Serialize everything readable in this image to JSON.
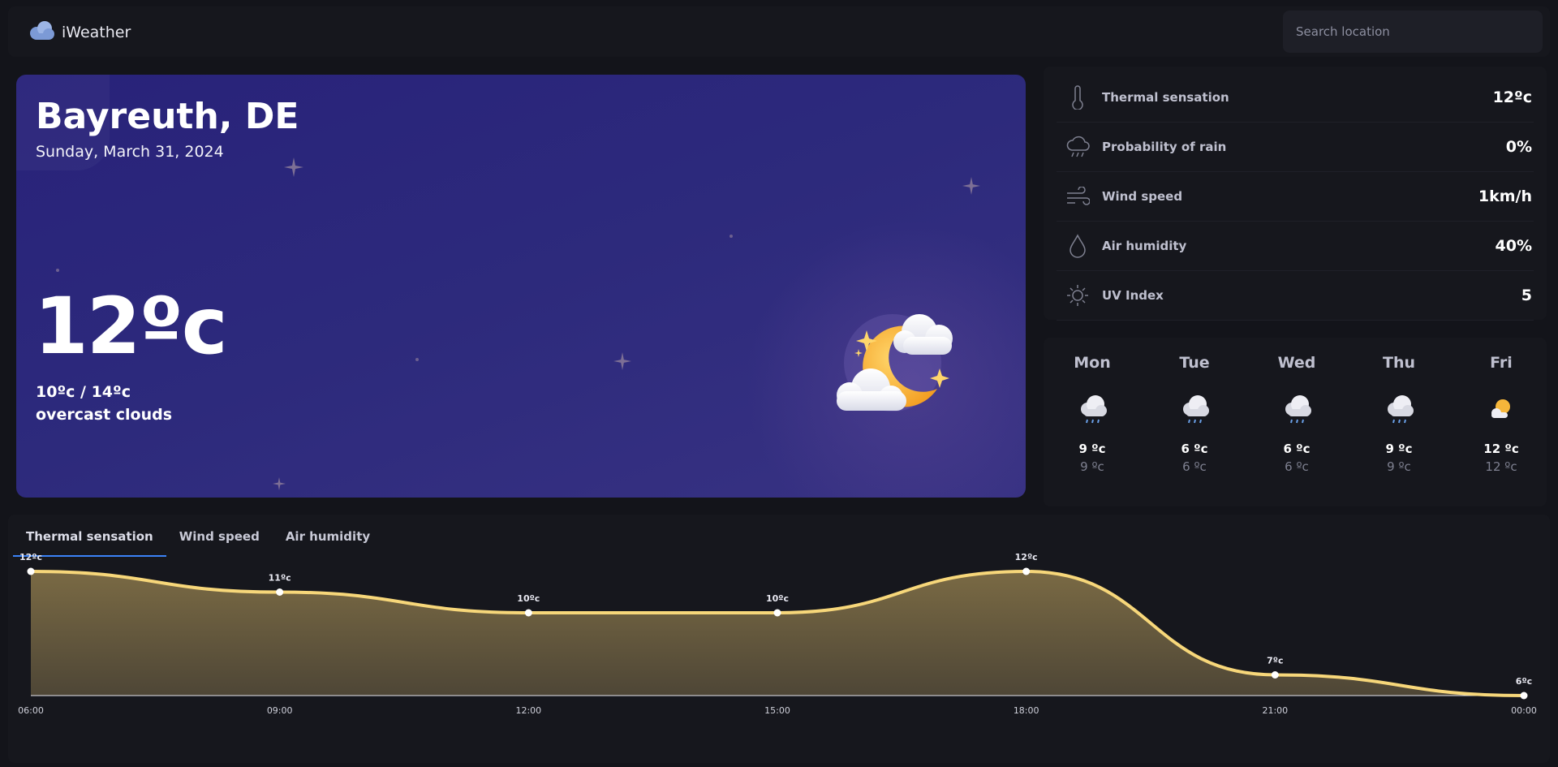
{
  "app": {
    "title": "iWeather",
    "logo_icon": "cloud-icon"
  },
  "search": {
    "placeholder": "Search location"
  },
  "current": {
    "city": "Bayreuth, DE",
    "date": "Sunday, March 31, 2024",
    "temperature": "12ºc",
    "min_max": "10ºc / 14ºc",
    "description": "overcast clouds",
    "icon": "moon-clouds-icon"
  },
  "details": [
    {
      "label": "Thermal sensation",
      "value": "12ºc",
      "icon": "thermometer-icon"
    },
    {
      "label": "Probability of rain",
      "value": "0%",
      "icon": "cloud-rain-icon"
    },
    {
      "label": "Wind speed",
      "value": "1km/h",
      "icon": "wind-icon"
    },
    {
      "label": "Air humidity",
      "value": "40%",
      "icon": "drop-icon"
    },
    {
      "label": "UV Index",
      "value": "5",
      "icon": "sun-icon"
    }
  ],
  "forecast": [
    {
      "day": "Mon",
      "max": "9 ºc",
      "min": "9 ºc",
      "icon": "rain-cloud-icon"
    },
    {
      "day": "Tue",
      "max": "6 ºc",
      "min": "6 ºc",
      "icon": "rain-cloud-icon"
    },
    {
      "day": "Wed",
      "max": "6 ºc",
      "min": "6 ºc",
      "icon": "rain-cloud-icon"
    },
    {
      "day": "Thu",
      "max": "9 ºc",
      "min": "9 ºc",
      "icon": "rain-cloud-icon"
    },
    {
      "day": "Fri",
      "max": "12 ºc",
      "min": "12 ºc",
      "icon": "sun-cloud-icon"
    }
  ],
  "tabs": [
    {
      "label": "Thermal sensation",
      "active": true
    },
    {
      "label": "Wind speed",
      "active": false
    },
    {
      "label": "Air humidity",
      "active": false
    }
  ],
  "colors": {
    "accent": "#3b82f6",
    "line": "#f7d77a",
    "hero": "#2d2a7c"
  },
  "chart_data": {
    "type": "area",
    "x": [
      "06:00",
      "09:00",
      "12:00",
      "15:00",
      "18:00",
      "21:00",
      "00:00"
    ],
    "values": [
      12,
      11,
      10,
      10,
      12,
      7,
      6
    ],
    "point_labels": [
      "12ºc",
      "11ºc",
      "10ºc",
      "10ºc",
      "12ºc",
      "7ºc",
      "6ºc"
    ],
    "ylim": [
      6,
      12
    ],
    "grid": false
  }
}
